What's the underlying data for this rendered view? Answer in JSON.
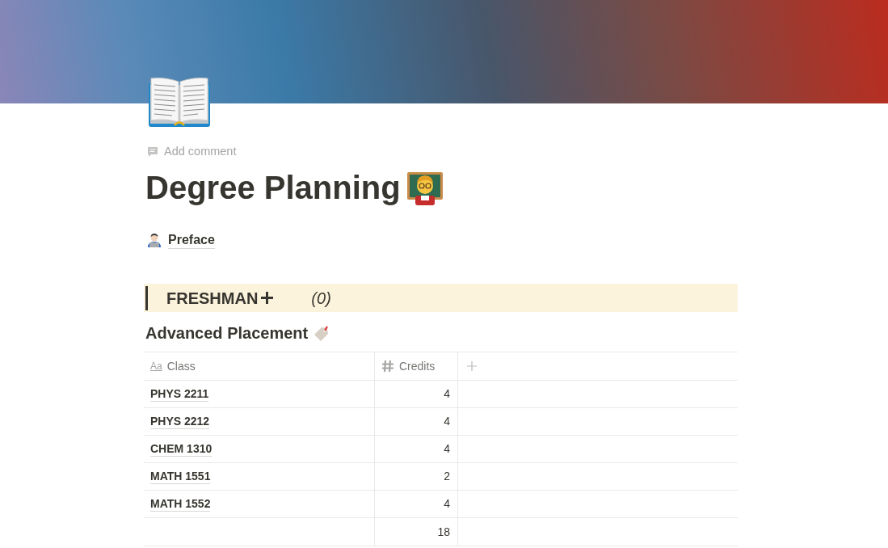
{
  "page": {
    "add_comment": "Add comment",
    "title": "Degree Planning"
  },
  "links": [
    {
      "label": "Preface"
    }
  ],
  "callout": {
    "title": "FRESHMAN",
    "count": "(0)"
  },
  "section_heading": "Advanced Placement",
  "table": {
    "columns": [
      {
        "kind": "title",
        "icon": "Aa",
        "label": "Class"
      },
      {
        "kind": "number",
        "label": "Credits"
      }
    ],
    "rows": [
      {
        "class": "PHYS 2211",
        "credits": "4"
      },
      {
        "class": "PHYS 2212",
        "credits": "4"
      },
      {
        "class": "CHEM 1310",
        "credits": "4"
      },
      {
        "class": "MATH 1551",
        "credits": "2"
      },
      {
        "class": "MATH 1552",
        "credits": "4"
      }
    ],
    "footer": {
      "credits": "18"
    }
  }
}
